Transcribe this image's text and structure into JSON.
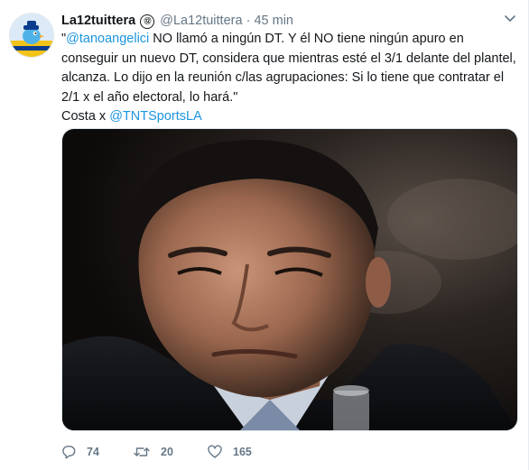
{
  "tweet": {
    "display_name": "La12tuittera",
    "badge": "⑫",
    "handle": "@La12tuittera",
    "separator": "·",
    "time": "45 min",
    "text": {
      "open_quote": "\"",
      "mention": "@tanoangelici",
      "body": " NO llamó a ningún DT. Y él NO tiene ningún apuro en conseguir un nuevo DT, considera que mientras esté el 3/1 delante del plantel, alcanza. Lo dijo en la reunión c/las agrupaciones: Si lo tiene que contratar el 2/1 x el año electoral, lo hará.\"",
      "credit_prefix": "Costa x ",
      "credit_mention": "@TNTSportsLA"
    },
    "photo_icon": "man-portrait-photo",
    "actions": {
      "reply_count": "74",
      "retweet_count": "20",
      "like_count": "165"
    }
  },
  "colors": {
    "link": "#1b95e0",
    "muted": "#657786",
    "text": "#14171a"
  }
}
